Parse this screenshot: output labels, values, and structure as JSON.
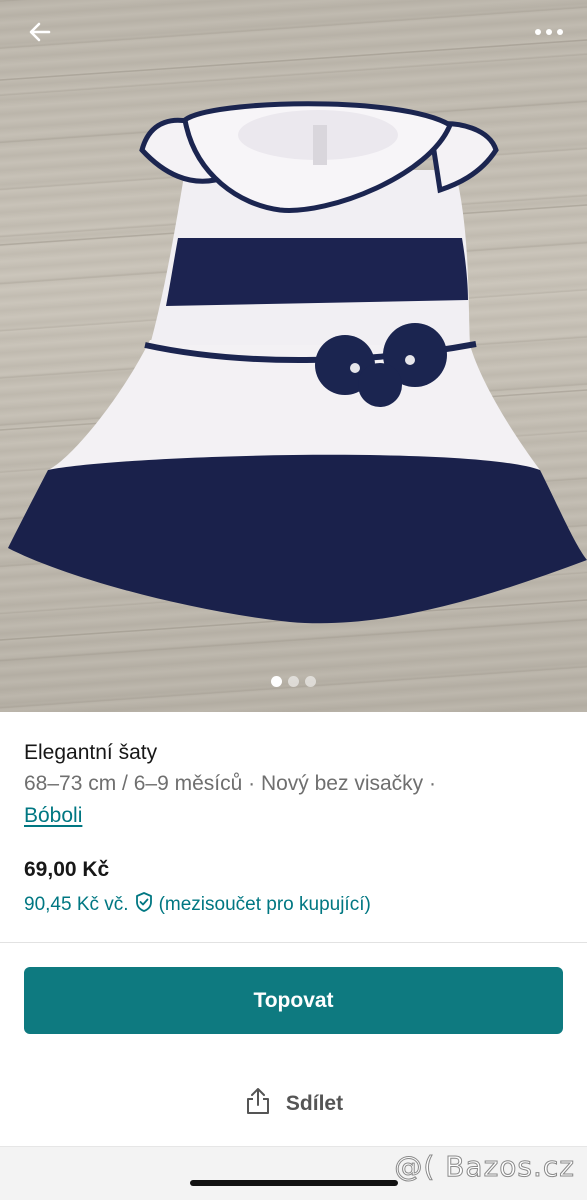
{
  "photo": {
    "alt_subject": "dress",
    "carousel": {
      "count": 3,
      "active_index": 0
    }
  },
  "header": {
    "back_icon": "arrow-left-icon",
    "more_icon": "more-horizontal-icon"
  },
  "item": {
    "title": "Elegantní šaty",
    "details": "68–73 cm / 6–9 měsíců · Nový bez visačky ·",
    "brand": "Bóboli",
    "price": "69,00 Kč",
    "price_with_protection": "90,45 Kč vč.",
    "price_note": "(mezisoučet pro kupující)"
  },
  "actions": {
    "primary_label": "Topovat",
    "share_label": "Sdílet"
  },
  "watermark": "@( Bazos.cz",
  "colors": {
    "accent": "#007782",
    "button": "#0e7a80",
    "navy": "#1b2550"
  }
}
